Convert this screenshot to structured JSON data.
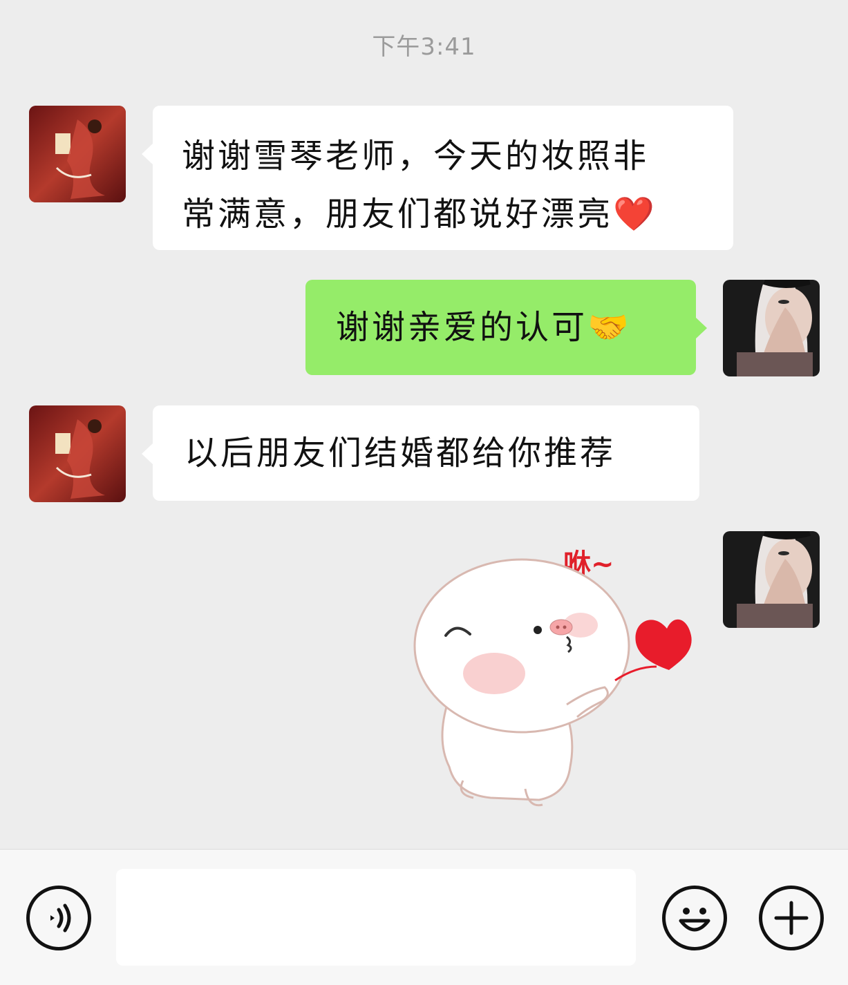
{
  "timestamp": "下午3:41",
  "messages": [
    {
      "direction": "in",
      "lines": [
        "谢谢雪琴老师，今天的妆照非",
        "常满意，朋友们都说好漂亮❤️"
      ]
    },
    {
      "direction": "out",
      "text": "谢谢亲爱的认可🤝"
    },
    {
      "direction": "in",
      "text": "以后朋友们结婚都给你推荐"
    },
    {
      "direction": "out",
      "type": "sticker",
      "sticker_text": "咻~"
    }
  ],
  "input": {
    "value": "",
    "placeholder": ""
  },
  "icons": {
    "voice": "voice-input-icon",
    "emoji": "emoji-icon",
    "more": "plus-icon"
  },
  "colors": {
    "background": "#ededed",
    "incoming_bubble": "#ffffff",
    "outgoing_bubble": "#95ec69",
    "timestamp": "#9b9b9b"
  }
}
